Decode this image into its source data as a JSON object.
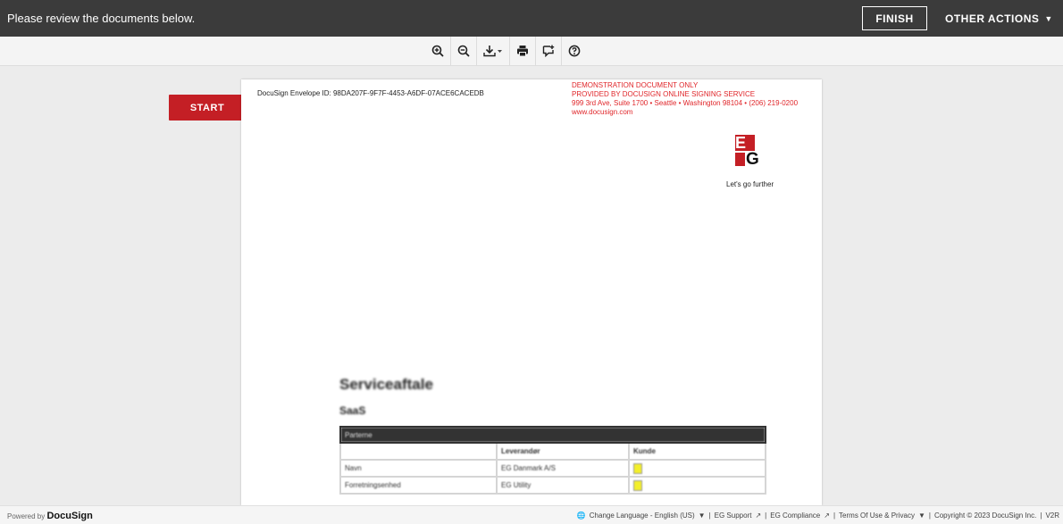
{
  "topbar": {
    "message": "Please review the documents below.",
    "finish_label": "FINISH",
    "other_actions_label": "OTHER ACTIONS",
    "other_actions_caret": "▼"
  },
  "toolbar": {
    "tools": [
      "zoom-in-icon",
      "zoom-out-icon",
      "download-icon",
      "print-icon",
      "comment-icon",
      "help-icon"
    ]
  },
  "document": {
    "start_label": "START",
    "envelope_id": "DocuSign Envelope ID: 98DA207F-9F7F-4453-A6DF-07ACE6CACEDB",
    "demo_lines": [
      "DEMONSTRATION DOCUMENT ONLY",
      "PROVIDED BY DOCUSIGN ONLINE SIGNING SERVICE",
      "999 3rd Ave, Suite 1700  • Seattle • Washington 98104 • (206) 219-0200",
      "www.docusign.com"
    ],
    "logo_top": "E",
    "logo_bottom": "G",
    "tagline": "Let's go further",
    "title": "Serviceaftale",
    "subtitle": "SaaS",
    "table": {
      "head": "Parterne",
      "header_row": [
        "",
        "Leverandør",
        "Kunde"
      ],
      "rows": [
        [
          "Navn",
          "EG Danmark A/S",
          ""
        ],
        [
          "Forretningsenhed",
          "EG Utility",
          ""
        ]
      ]
    },
    "colors": {
      "accent": "#c41f25",
      "demo_text": "#e0262a"
    }
  },
  "footer": {
    "powered_prefix": "Powered by",
    "powered_brand": "DocuSign",
    "change_language": "Change Language - English (US)",
    "eg_support": "EG Support",
    "eg_compliance": "EG Compliance",
    "terms": "Terms Of Use & Privacy",
    "copyright": "Copyright © 2023 DocuSign Inc.",
    "version": "V2R"
  }
}
